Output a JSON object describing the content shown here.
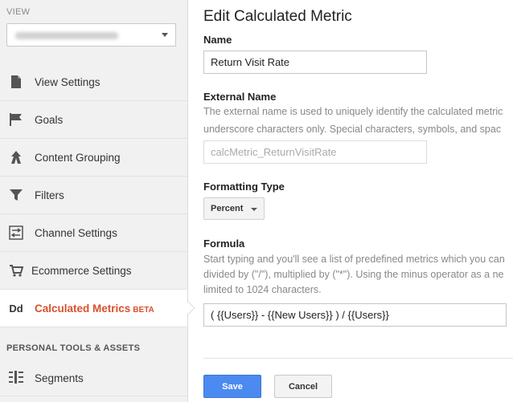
{
  "sidebar": {
    "view_label": "VIEW",
    "nav_items": [
      {
        "label": "View Settings",
        "icon": "document-icon"
      },
      {
        "label": "Goals",
        "icon": "flag-icon"
      },
      {
        "label": "Content Grouping",
        "icon": "person-walking-icon"
      },
      {
        "label": "Filters",
        "icon": "funnel-icon"
      },
      {
        "label": "Channel Settings",
        "icon": "sliders-icon"
      },
      {
        "label": "Ecommerce Settings",
        "icon": "cart-icon"
      },
      {
        "label": "Calculated Metrics",
        "badge": "BETA",
        "icon": "dd-icon",
        "active": true
      }
    ],
    "dd_icon_text": "Dd",
    "section_title": "PERSONAL TOOLS & ASSETS",
    "segments_label": "Segments"
  },
  "main": {
    "title": "Edit Calculated Metric",
    "name_label": "Name",
    "name_value": "Return Visit Rate",
    "external_name_label": "External Name",
    "external_help_1": "The external name is used to uniquely identify the calculated metric",
    "external_help_2": "underscore characters only. Special characters, symbols, and spac",
    "external_name_value": "calcMetric_ReturnVisitRate",
    "formatting_label": "Formatting Type",
    "formatting_value": "Percent",
    "formula_label": "Formula",
    "formula_help_1": "Start typing and you'll see a list of predefined metrics which you can",
    "formula_help_2": "divided by (\"/\"), multiplied by (\"*\"). Using the minus operator as a ne",
    "formula_help_3": "limited to 1024 characters.",
    "formula_value": "( {{Users}} - {{New Users}} ) / {{Users}}",
    "save_label": "Save",
    "cancel_label": "Cancel"
  },
  "colors": {
    "accent": "#d9502f",
    "primary_button": "#4b8af0",
    "sidebar_bg": "#f1f1f1"
  }
}
